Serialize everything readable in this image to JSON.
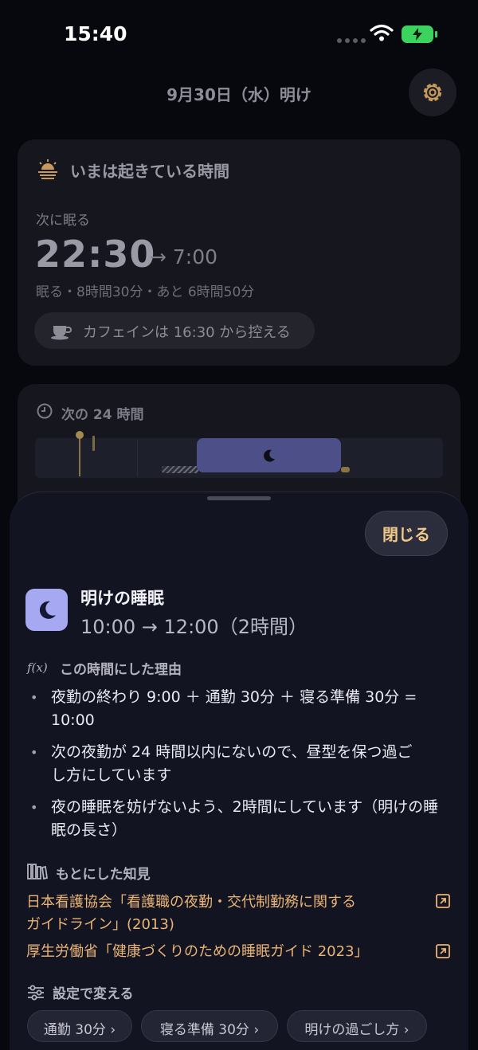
{
  "status_bar": {
    "time": "15:40"
  },
  "header": {
    "date_title": "9月30日（水）明け"
  },
  "awake_card": {
    "title": "いまは起きている時間",
    "next_sleep_label": "次に眠る",
    "sleep_time": "22:30",
    "wake_time": "→ 7:00",
    "summary": "眠る・8時間30分・あと 6時間50分",
    "caffeine_note": "カフェインは 16:30 から控える"
  },
  "timeline_card": {
    "title": "次の 24 時間"
  },
  "sheet": {
    "close_label": "閉じる",
    "title": "明けの睡眠",
    "time_range": "10:00 → 12:00（2時間）",
    "reason_heading": "この時間にした理由",
    "fx_label": "f(x)",
    "reasons": [
      "夜勤の終わり 9:00 ＋ 通勤 30分 ＋ 寝る準備 30分 = 10:00",
      "次の夜勤が 24 時間以内にないので、昼型を保つ過ごし方にしています",
      "夜の睡眠を妨げないよう、2時間にしています（明けの睡眠の長さ）"
    ],
    "basis_heading": "もとにした知見",
    "references": [
      "日本看護協会「看護職の夜勤・交代制勤務に関するガイドライン」(2013)",
      "厚生労働省「健康づくりのための睡眠ガイド 2023」"
    ],
    "settings_heading": "設定で変える",
    "setting_chips": [
      "通勤 30分 ›",
      "寝る準備 30分 ›",
      "明けの過ごし方 ›"
    ]
  },
  "colors": {
    "accent": "#eab574",
    "moon_tile": "#a6a8f2",
    "sleep_bar": "#4d5088",
    "battery": "#3bd35e"
  }
}
